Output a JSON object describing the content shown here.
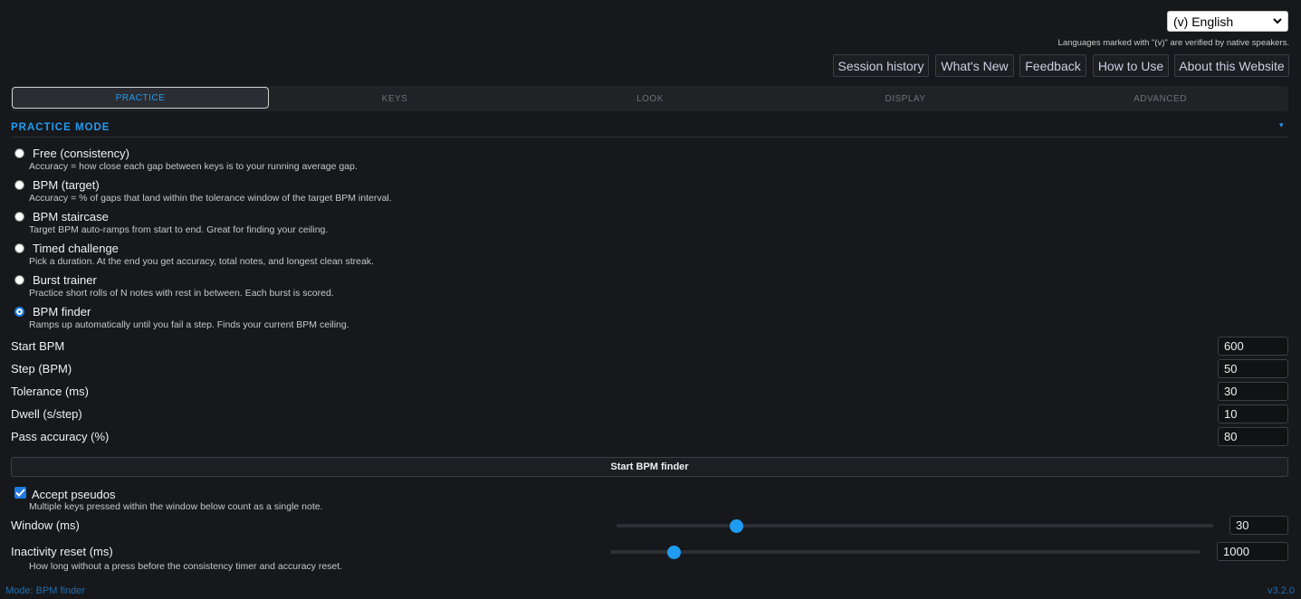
{
  "language": {
    "selected": "(v) English",
    "note": "Languages marked with \"(v)\" are verified by native speakers."
  },
  "nav": {
    "session_history": "Session history",
    "whats_new": "What's New",
    "feedback": "Feedback",
    "how_to_use": "How to Use",
    "about": "About this Website"
  },
  "tabs": [
    "PRACTICE",
    "KEYS",
    "LOOK",
    "DISPLAY",
    "ADVANCED"
  ],
  "active_tab": "PRACTICE",
  "section": {
    "title": "PRACTICE MODE"
  },
  "modes": [
    {
      "label": "Free (consistency)",
      "desc": "Accuracy = how close each gap between keys is to your running average gap.",
      "checked": false
    },
    {
      "label": "BPM (target)",
      "desc": "Accuracy = % of gaps that land within the tolerance window of the target BPM interval.",
      "checked": false
    },
    {
      "label": "BPM staircase",
      "desc": "Target BPM auto-ramps from start to end. Great for finding your ceiling.",
      "checked": false
    },
    {
      "label": "Timed challenge",
      "desc": "Pick a duration. At the end you get accuracy, total notes, and longest clean streak.",
      "checked": false
    },
    {
      "label": "Burst trainer",
      "desc": "Practice short rolls of N notes with rest in between. Each burst is scored.",
      "checked": false
    },
    {
      "label": "BPM finder",
      "desc": "Ramps up automatically until you fail a step. Finds your current BPM ceiling.",
      "checked": true
    }
  ],
  "params": [
    {
      "label": "Start BPM",
      "value": "600"
    },
    {
      "label": "Step (BPM)",
      "value": "50"
    },
    {
      "label": "Tolerance (ms)",
      "value": "30"
    },
    {
      "label": "Dwell (s/step)",
      "value": "10"
    },
    {
      "label": "Pass accuracy (%)",
      "value": "80"
    }
  ],
  "start_button": "Start BPM finder",
  "pseudos": {
    "label": "Accept pseudos",
    "desc": "Multiple keys pressed within the window below count as a single note.",
    "checked": true
  },
  "window_slider": {
    "label": "Window (ms)",
    "value": "30",
    "fraction": 0.2
  },
  "inactivity_slider": {
    "label": "Inactivity reset (ms)",
    "value": "1000",
    "fraction": 0.11,
    "desc": "How long without a press before the consistency timer and accuracy reset."
  },
  "status": {
    "mode": "Mode: BPM finder",
    "version": "v3.2.0"
  },
  "colors": {
    "accent": "#1f9cf0",
    "background": "#17181b"
  }
}
